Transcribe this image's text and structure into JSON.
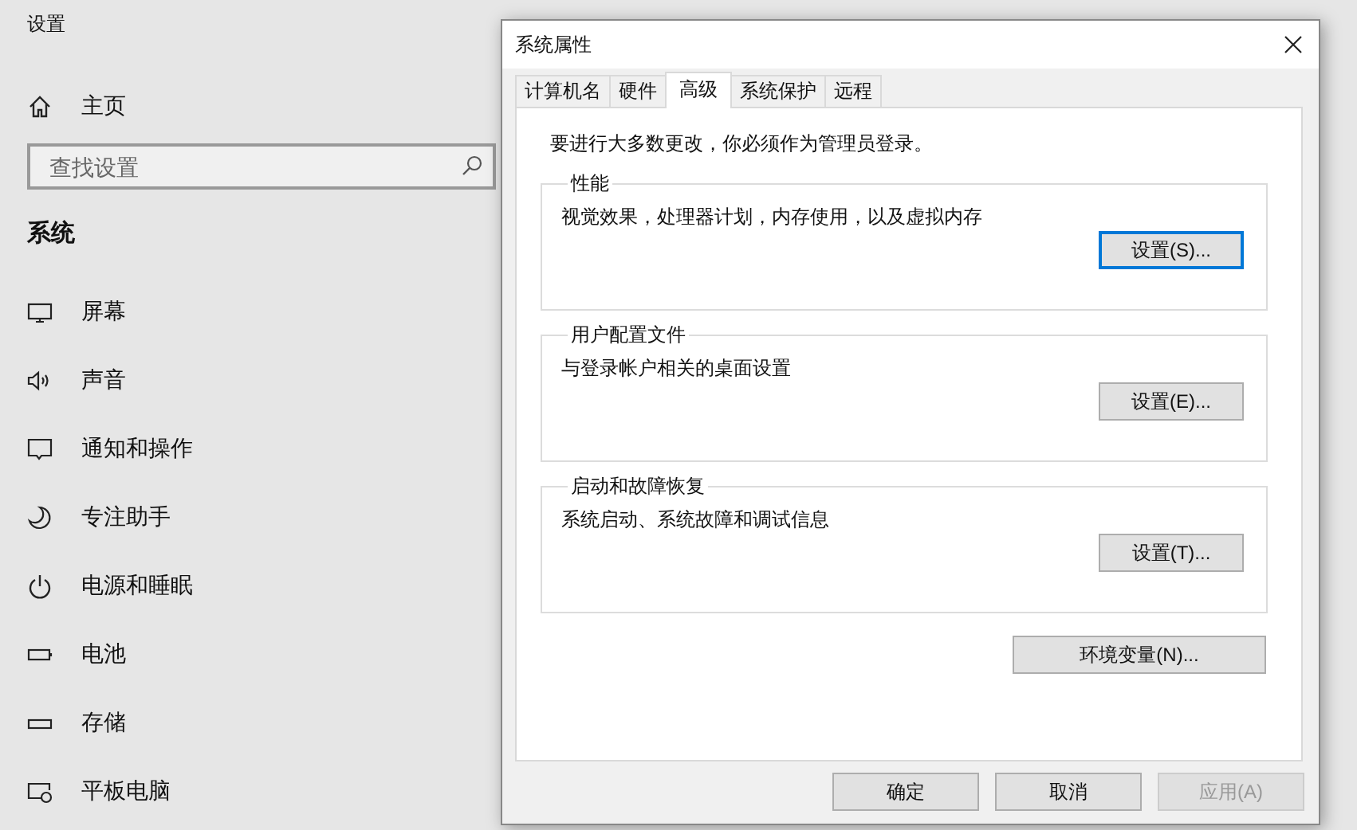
{
  "settings": {
    "title": "设置",
    "home": "主页",
    "search": {
      "placeholder": "查找设置"
    },
    "section": "系统",
    "items": [
      {
        "kind": "display",
        "label": "屏幕"
      },
      {
        "kind": "sound",
        "label": "声音"
      },
      {
        "kind": "notification",
        "label": "通知和操作"
      },
      {
        "kind": "focus",
        "label": "专注助手"
      },
      {
        "kind": "power",
        "label": "电源和睡眠"
      },
      {
        "kind": "battery",
        "label": "电池"
      },
      {
        "kind": "storage",
        "label": "存储"
      },
      {
        "kind": "tablet",
        "label": "平板电脑"
      }
    ]
  },
  "dialog": {
    "title": "系统属性",
    "tabs": [
      {
        "label": "计算机名",
        "selected": false
      },
      {
        "label": "硬件",
        "selected": false
      },
      {
        "label": "高级",
        "selected": true
      },
      {
        "label": "系统保护",
        "selected": false
      },
      {
        "label": "远程",
        "selected": false
      }
    ],
    "note": "要进行大多数更改，你必须作为管理员登录。",
    "groups": [
      {
        "title": "性能",
        "description": "视觉效果，处理器计划，内存使用，以及虚拟内存",
        "button": "设置(S)...",
        "focused": true
      },
      {
        "title": "用户配置文件",
        "description": "与登录帐户相关的桌面设置",
        "button": "设置(E)...",
        "focused": false
      },
      {
        "title": "启动和故障恢复",
        "description": "系统启动、系统故障和调试信息",
        "button": "设置(T)...",
        "focused": false
      }
    ],
    "env_button": "环境变量(N)...",
    "buttons": [
      {
        "label": "确定",
        "disabled": false
      },
      {
        "label": "取消",
        "disabled": false
      },
      {
        "label": "应用(A)",
        "disabled": true
      }
    ]
  }
}
